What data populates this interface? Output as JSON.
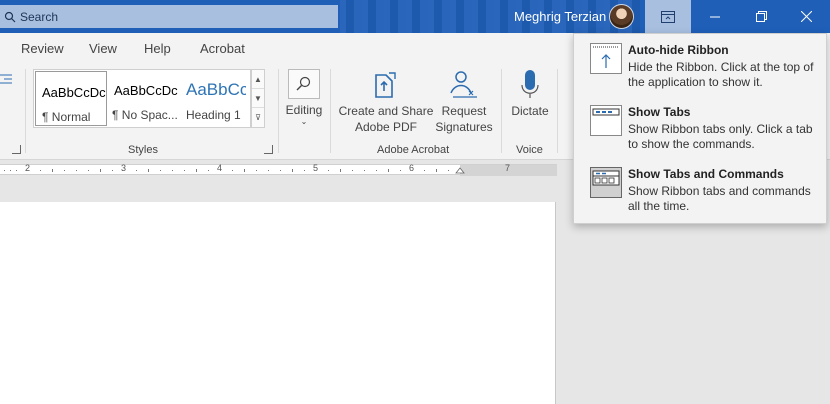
{
  "titlebar": {
    "search_placeholder": "Search",
    "user_name": "Meghrig Terzian",
    "buttons": [
      "ribbon-display-options",
      "minimize",
      "restore",
      "close"
    ]
  },
  "tabs": [
    "Review",
    "View",
    "Help",
    "Acrobat"
  ],
  "ribbon": {
    "styles_group": {
      "label": "Styles",
      "items": [
        {
          "sample": "AaBbCcDc",
          "name": "¶ Normal",
          "selected": true
        },
        {
          "sample": "AaBbCcDc",
          "name": "¶ No Spac..."
        },
        {
          "sample": "AaBbCc",
          "name": "Heading 1"
        }
      ]
    },
    "editing_label": "Editing",
    "acrobat_group": {
      "label": "Adobe Acrobat",
      "create_share": [
        "Create and Share",
        "Adobe PDF"
      ],
      "request_sign": [
        "Request",
        "Signatures"
      ]
    },
    "voice_group": {
      "label": "Voice",
      "dictate": "Dictate"
    }
  },
  "ruler": {
    "numbers": [
      "2",
      "3",
      "4",
      "5",
      "6",
      "7"
    ]
  },
  "ribbon_menu": {
    "items": [
      {
        "title": "Auto-hide Ribbon",
        "desc": "Hide the Ribbon. Click at the top of the application to show it.",
        "icon": "auto-hide-icon"
      },
      {
        "title": "Show Tabs",
        "desc": "Show Ribbon tabs only. Click a tab to show the commands.",
        "icon": "show-tabs-icon"
      },
      {
        "title": "Show Tabs and Commands",
        "desc": "Show Ribbon tabs and commands all the time.",
        "icon": "show-tabs-commands-icon",
        "active": true
      }
    ]
  },
  "colors": {
    "titlebar": "#1f5fb8",
    "search": "#a8bfe0",
    "accent_icon": "#2b6cb0"
  }
}
